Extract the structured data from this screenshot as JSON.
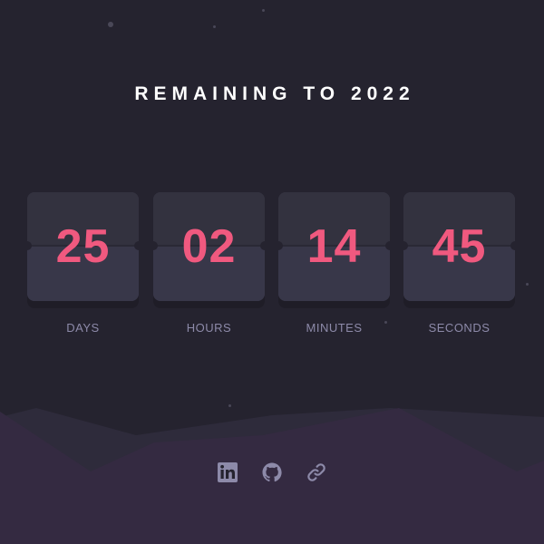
{
  "title": "REMAINING TO 2022",
  "countdown": [
    {
      "value": "25",
      "label": "DAYS"
    },
    {
      "value": "02",
      "label": "HOURS"
    },
    {
      "value": "14",
      "label": "MINUTES"
    },
    {
      "value": "45",
      "label": "SECONDS"
    }
  ],
  "social": [
    {
      "icon": "linkedin-icon"
    },
    {
      "icon": "github-icon"
    },
    {
      "icon": "link-icon"
    }
  ],
  "colors": {
    "background": "#25232f",
    "card": "#383749",
    "digits": "#f0597f",
    "label": "#8d8aa9",
    "hills_back": "#2e2b3b",
    "hills_front": "#342a41",
    "icon": "#8d8aa9"
  }
}
